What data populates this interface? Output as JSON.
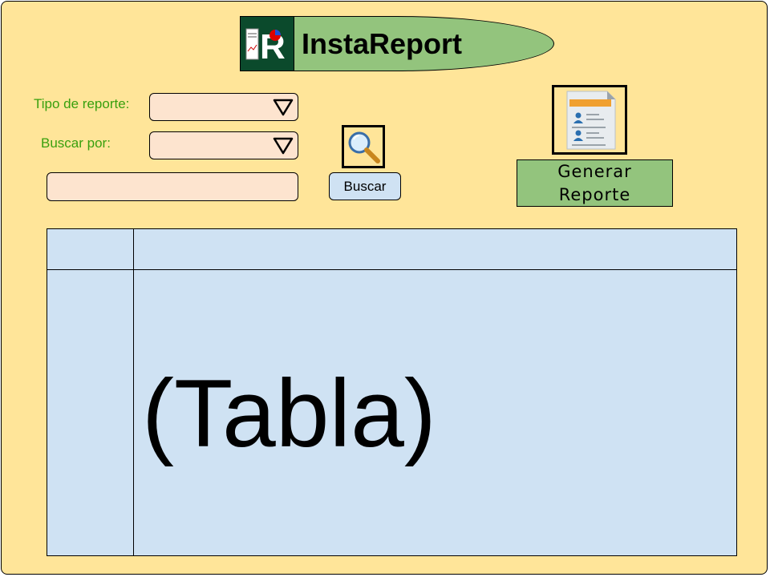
{
  "app": {
    "title": "InstaReport",
    "logo_icon": "instareport-logo-icon",
    "logo_letter": "R"
  },
  "filters": {
    "report_type_label": "Tipo de reporte:",
    "report_type_value": "",
    "search_by_label": "Buscar por:",
    "search_by_value": "",
    "search_text_value": "",
    "dropdown_icon": "triangle-down-icon"
  },
  "search": {
    "icon": "magnifier-icon",
    "button_label": "Buscar"
  },
  "report": {
    "icon": "report-document-icon",
    "generate_line1": "Generar",
    "generate_line2": "Reporte"
  },
  "table": {
    "placeholder": "(Tabla)"
  },
  "colors": {
    "background": "#ffe599",
    "header_green": "#93c47d",
    "logo_dark_green": "#0b4a2c",
    "label_green": "#38a00e",
    "input_fill": "#fde4cf",
    "table_fill": "#cfe2f3"
  }
}
